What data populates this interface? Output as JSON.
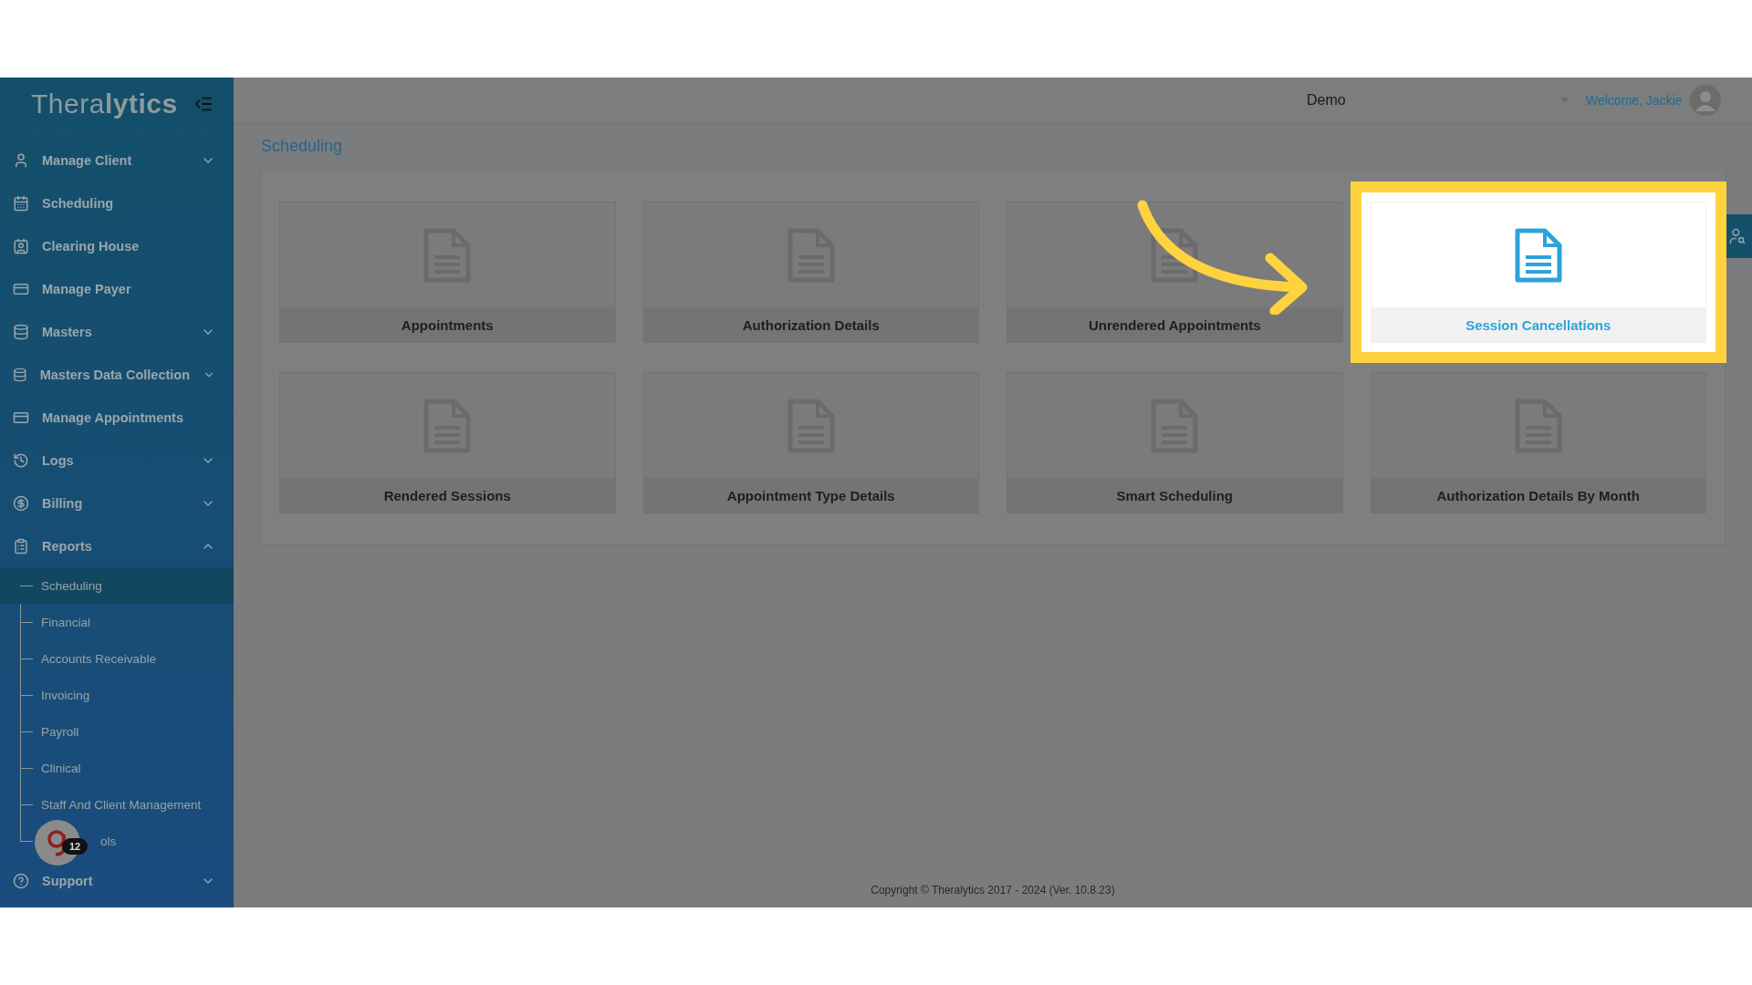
{
  "sidebar": {
    "logo": "Thera**lytics**",
    "items": [
      {
        "label": "Manage Client",
        "expanded": false
      },
      {
        "label": "Scheduling"
      },
      {
        "label": "Clearing House"
      },
      {
        "label": "Manage Payer"
      },
      {
        "label": "Masters",
        "expanded": false
      },
      {
        "label": "Masters Data Collection",
        "expanded": false
      },
      {
        "label": "Manage Appointments"
      },
      {
        "label": "Logs",
        "expanded": false
      },
      {
        "label": "Billing",
        "expanded": false
      },
      {
        "label": "Reports",
        "expanded": true,
        "children": [
          {
            "label": "Scheduling",
            "selected": true,
            "kind": "plain"
          },
          {
            "label": "Financial",
            "selected": false,
            "kind": "plain"
          },
          {
            "label": "Accounts Receivable",
            "selected": false,
            "kind": "plain"
          },
          {
            "label": "Invoicing",
            "selected": false,
            "kind": "plain"
          },
          {
            "label": "Payroll",
            "selected": false,
            "kind": "plain"
          },
          {
            "label": "Clinical",
            "selected": false,
            "kind": "plain"
          },
          {
            "label": "Staff And Client Management",
            "selected": false,
            "kind": "plain"
          },
          {
            "label": "ols",
            "selected": false,
            "kind": "covered"
          }
        ]
      },
      {
        "label": "Support",
        "expanded": false
      }
    ]
  },
  "header": {
    "organization": "Demo",
    "welcome": "Welcome, Jackie"
  },
  "page_title": "Scheduling",
  "cards": [
    {
      "label": "Appointments",
      "highlighted": false
    },
    {
      "label": "Authorization Details",
      "highlighted": false
    },
    {
      "label": "Unrendered Appointments",
      "highlighted": false
    },
    {
      "label": "Session Cancellations",
      "highlighted": true
    },
    {
      "label": "Rendered Sessions",
      "highlighted": false
    },
    {
      "label": "Appointment Type Details",
      "highlighted": false
    },
    {
      "label": "Smart Scheduling",
      "highlighted": false
    },
    {
      "label": "Authorization Details By Month",
      "highlighted": false
    }
  ],
  "helper_widget": {
    "badge": "12"
  },
  "footer": "Copyright © Theralytics 2017 - 2024 (Ver. 10.8.23)"
}
